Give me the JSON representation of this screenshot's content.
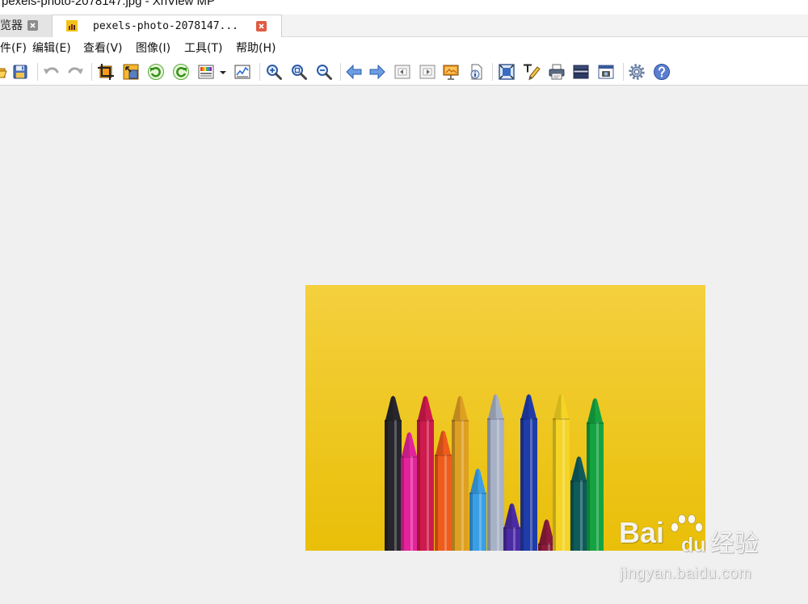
{
  "window": {
    "title": "pexels-photo-2078147.jpg - XnView MP"
  },
  "tabs": [
    {
      "label": "览器",
      "active": false
    },
    {
      "label": "pexels-photo-2078147...",
      "active": true
    }
  ],
  "menu": {
    "items": [
      "件(F)",
      "编辑(E)",
      "查看(V)",
      "图像(I)",
      "工具(T)",
      "帮助(H)"
    ]
  },
  "toolbar": {
    "icons": [
      "open-folder-icon",
      "save-icon",
      "undo-icon",
      "redo-icon",
      "crop-icon",
      "resize-icon",
      "rotate-left-icon",
      "rotate-right-icon",
      "adjust-colors-icon",
      "dropdown-arrow-icon",
      "histogram-icon",
      "zoom-in-icon",
      "zoom-fit-icon",
      "zoom-out-icon",
      "previous-arrow-icon",
      "next-arrow-icon",
      "previous-page-icon",
      "next-page-icon",
      "slideshow-icon",
      "properties-icon",
      "fullscreen-icon",
      "edit-text-icon",
      "print-icon",
      "scan-icon",
      "capture-icon",
      "settings-icon",
      "help-icon"
    ]
  },
  "watermark": {
    "brand_left": "Bai",
    "brand_right": "du",
    "brand_cn": "经验",
    "url": "jingyan.baidu.com"
  },
  "colors": {
    "workspace": "#f0f0f0",
    "active_tab_close": "#e05a42",
    "image_background": "#eec421"
  }
}
